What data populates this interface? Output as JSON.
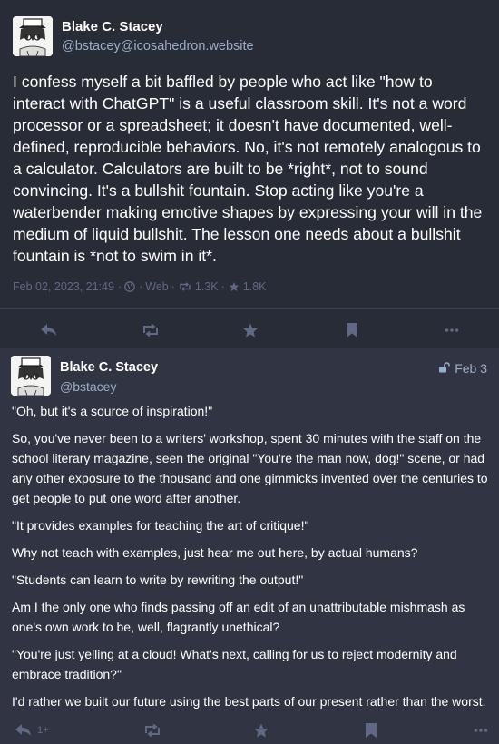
{
  "post1": {
    "author_name": "Blake C. Stacey",
    "author_handle": "@bstacey@icosahedron.website",
    "content": "I confess myself a bit baffled by people who act like \"how to interact with ChatGPT\" is a useful classroom skill. It's not a word processor or a spreadsheet; it doesn't have documented, well-defined, reproducible behaviors. No, it's not remotely analogous to a calculator. Calculators are built to be *right*, not to sound convincing. It's a bullshit fountain. Stop acting like you're a waterbender making emotive shapes by expressing your will in the medium of liquid bullshit. The lesson one needs about a bullshit fountain is *not to swim in it*.",
    "timestamp": "Feb 02, 2023, 21:49",
    "separator": "·",
    "visibility_icon": "globe-icon",
    "application": "Web",
    "boost_count": "1.3K",
    "favourite_count": "1.8K",
    "actions": [
      "reply-icon",
      "boost-icon",
      "star-icon",
      "bookmark-icon",
      "ellipsis-icon"
    ]
  },
  "post2": {
    "author_name": "Blake C. Stacey",
    "author_handle": "@bstacey",
    "visibility_icon": "unlock-icon",
    "relative_time": "Feb 3",
    "paragraphs": [
      "\"Oh, but it's a source of inspiration!\"",
      "So, you've never been to a writers' workshop, spent 30 minutes with the staff on the school literary magazine, seen the original \"You're the man now, dog!\" scene, or had any other exposure to the thousand and one gimmicks invented over the centuries to get people to put one word after another.",
      "\"It provides examples for teaching the art of critique!\"",
      "Why not teach with examples, just hear me out here, by actual humans?",
      "\"Students can learn to write by rewriting the output!\"",
      "Am I the only one who finds passing off an edit of an unattributable mishmash as one's own work to be, well, flagrantly unethical?",
      "\"You're just yelling at a cloud! What's next, calling for us to reject modernity and embrace tradition?\"",
      "I'd rather we built our future using the best parts of our present rather than the worst."
    ],
    "reply_count": "1+",
    "actions": [
      "reply-icon",
      "boost-icon",
      "star-icon",
      "bookmark-icon",
      "ellipsis-icon"
    ]
  },
  "colors": {
    "focused_background": "#282c37",
    "thread_background": "#313543",
    "text": "#ffffff",
    "handle": "#9baec8",
    "muted": "#606984"
  }
}
